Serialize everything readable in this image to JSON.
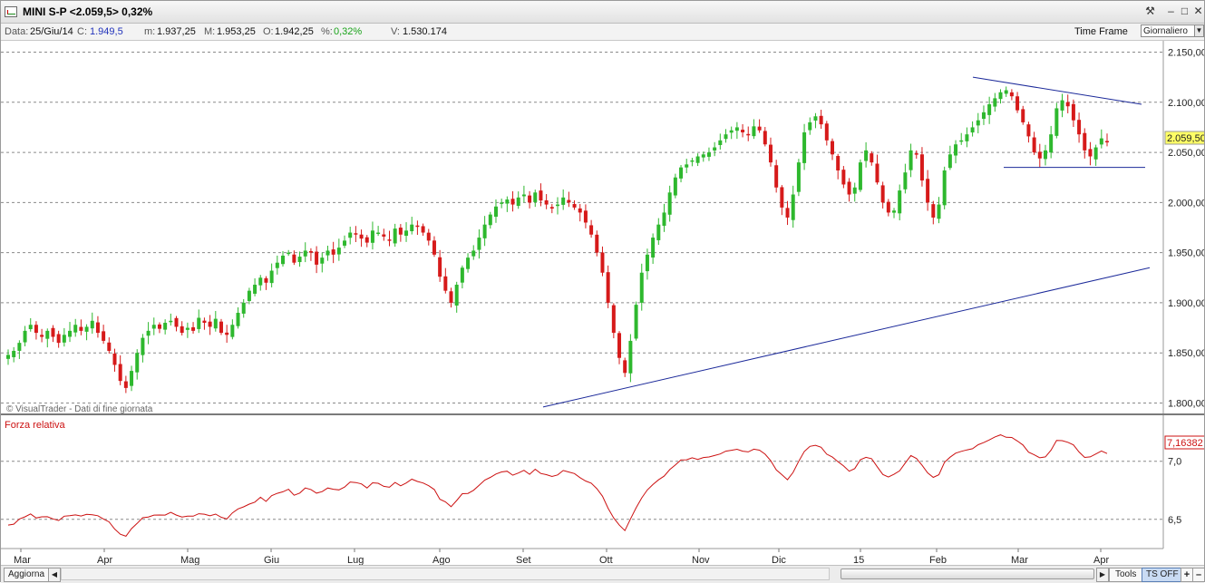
{
  "window": {
    "title": "MINI S-P <2.059,5> 0,32%"
  },
  "infobar": {
    "data_label": "Data:",
    "data_value": "25/Giu/14",
    "close_label": "C:",
    "close_value": "1.949,5",
    "min_label": "m:",
    "min_value": "1.937,25",
    "max_label": "M:",
    "max_value": "1.953,25",
    "open_label": "O:",
    "open_value": "1.942,25",
    "pct_label": "%:",
    "pct_value": "0,32%",
    "vol_label": "V:",
    "vol_value": "1.530.174",
    "timeframe_label": "Time Frame",
    "timeframe_value": "Giornaliero"
  },
  "colors": {
    "up": "#2eb82e",
    "down": "#d61a1a",
    "trendline": "#1c2a9a",
    "rsi": "#cc1111",
    "grid": "#8a8a8a",
    "close_value_color": "#2233bb",
    "pct_color": "#1aa31a",
    "last_price_bg": "#ffff66"
  },
  "main_panel": {
    "watermark": "© VisualTrader - Dati di fine giornata",
    "last_price_label": "2.059,50"
  },
  "sub_panel": {
    "title": "Forza relativa",
    "last_value_label": "7,16382"
  },
  "chart_data": [
    {
      "type": "candlestick",
      "ticker": "MINI S-P",
      "y_ticks": [
        "2.150,00",
        "2.100,00",
        "2.050,00",
        "2.000,00",
        "1.950,00",
        "1.900,00",
        "1.850,00",
        "1.800,00"
      ],
      "ylim": [
        1795,
        2155
      ],
      "grid": "horizontal dashed",
      "x_ticks": [
        "Mar",
        "Apr",
        "Mag",
        "Giu",
        "Lug",
        "Ago",
        "Set",
        "Ott",
        "Nov",
        "Dic",
        "15",
        "Feb",
        "Mar",
        "Apr"
      ],
      "close_series": [
        1848,
        1852,
        1860,
        1872,
        1878,
        1870,
        1866,
        1872,
        1866,
        1860,
        1868,
        1872,
        1878,
        1872,
        1876,
        1882,
        1870,
        1862,
        1852,
        1838,
        1822,
        1815,
        1832,
        1850,
        1865,
        1872,
        1878,
        1874,
        1880,
        1882,
        1876,
        1870,
        1875,
        1872,
        1885,
        1880,
        1876,
        1884,
        1870,
        1868,
        1878,
        1890,
        1900,
        1912,
        1918,
        1925,
        1920,
        1932,
        1940,
        1947,
        1950,
        1940,
        1946,
        1952,
        1950,
        1938,
        1945,
        1952,
        1948,
        1955,
        1962,
        1970,
        1968,
        1964,
        1960,
        1972,
        1970,
        1966,
        1962,
        1974,
        1968,
        1972,
        1978,
        1976,
        1970,
        1962,
        1948,
        1926,
        1912,
        1900,
        1918,
        1935,
        1945,
        1952,
        1965,
        1978,
        1988,
        1996,
        2000,
        2003,
        1998,
        2005,
        2008,
        2000,
        2010,
        2002,
        1998,
        1994,
        1998,
        2005,
        2000,
        1995,
        1990,
        1980,
        1968,
        1950,
        1930,
        1900,
        1870,
        1845,
        1830,
        1862,
        1898,
        1930,
        1948,
        1965,
        1978,
        1990,
        2010,
        2025,
        2035,
        2038,
        2042,
        2046,
        2048,
        2050,
        2055,
        2062,
        2068,
        2072,
        2075,
        2070,
        2068,
        2076,
        2072,
        2058,
        2040,
        2015,
        1995,
        1985,
        2008,
        2040,
        2070,
        2080,
        2086,
        2078,
        2062,
        2048,
        2032,
        2018,
        2008,
        2015,
        2040,
        2052,
        2040,
        2020,
        2000,
        1990,
        1992,
        2012,
        2030,
        2052,
        2048,
        2022,
        2000,
        1985,
        1998,
        2032,
        2048,
        2058,
        2062,
        2068,
        2075,
        2082,
        2090,
        2098,
        2104,
        2110,
        2112,
        2106,
        2092,
        2080,
        2066,
        2050,
        2044,
        2052,
        2068,
        2094,
        2102,
        2096,
        2082,
        2068,
        2052,
        2046,
        2055,
        2064,
        2060
      ]
    },
    {
      "type": "line",
      "name": "Forza relativa",
      "y_ticks": [
        "7,0",
        "6,5"
      ],
      "ylim": [
        6.28,
        7.38
      ],
      "grid": "horizontal dashed",
      "x_ticks": [
        "Mar",
        "Apr",
        "Mag",
        "Giu",
        "Lug",
        "Ago",
        "Set",
        "Ott",
        "Nov",
        "Dic",
        "15",
        "Feb",
        "Mar",
        "Apr"
      ],
      "last_value": 7.16382
    }
  ]
}
